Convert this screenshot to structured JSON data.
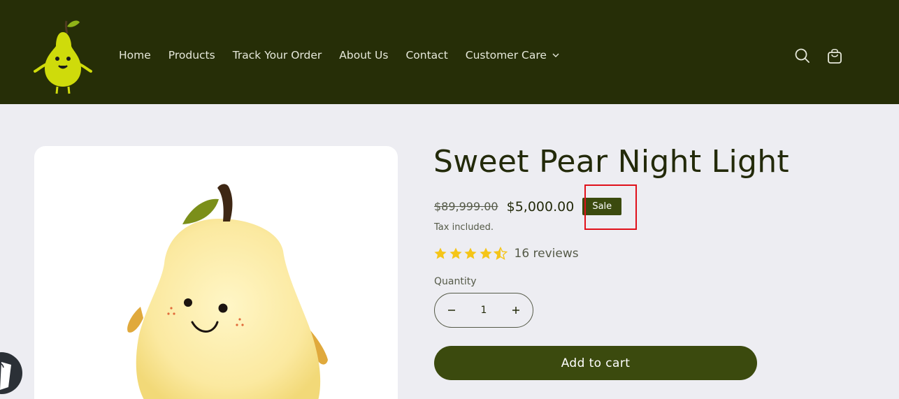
{
  "nav": {
    "items": [
      {
        "label": "Home"
      },
      {
        "label": "Products"
      },
      {
        "label": "Track Your Order"
      },
      {
        "label": "About Us"
      },
      {
        "label": "Contact"
      },
      {
        "label": "Customer Care"
      }
    ]
  },
  "product": {
    "title": "Sweet Pear Night Light",
    "regular_price": "$89,999.00",
    "sale_price": "$5,000.00",
    "sale_badge": "Sale",
    "tax_note": "Tax included.",
    "rating": 4.5,
    "reviews": "16 reviews",
    "quantity_label": "Quantity",
    "quantity": "1",
    "add_to_cart": "Add to cart"
  },
  "colors": {
    "header_bg": "#262e07",
    "page_bg": "#ededf2",
    "accent": "#3b4a0e",
    "star": "#f5c518",
    "highlight": "#e0101a"
  },
  "icons": [
    "pear-logo",
    "search-icon",
    "cart-icon",
    "chevron-down-icon",
    "star-icon",
    "minus-icon",
    "plus-icon",
    "shopify-bag-icon"
  ]
}
